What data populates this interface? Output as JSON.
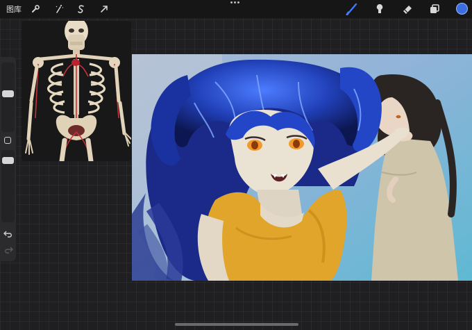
{
  "toolbar": {
    "gallery_label": "图库",
    "left_tools": [
      "wrench-icon",
      "magic-wand-icon",
      "selection-icon",
      "transform-icon"
    ],
    "right_tools": [
      "brush-icon",
      "smudge-icon",
      "eraser-icon",
      "layers-icon"
    ],
    "active_tool": "brush-icon",
    "current_color": "#3b6fe0"
  },
  "sidebar": {
    "sliders": [
      "brush-size-slider",
      "opacity-slider"
    ],
    "buttons": [
      "modify-button",
      "undo-button",
      "redo-button"
    ]
  },
  "reference": {
    "content": "skeleton-reference-image"
  },
  "canvas": {
    "content": "artwork"
  }
}
